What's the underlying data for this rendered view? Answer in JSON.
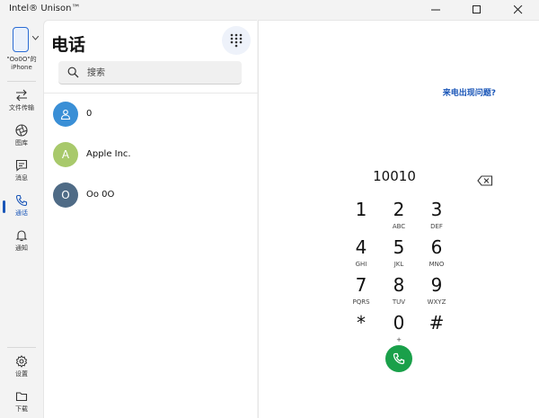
{
  "window": {
    "title": "Intel® Unison™"
  },
  "nav": {
    "device_name": "\"Oo0O\"的 iPhone",
    "items": [
      {
        "label": "文件传输",
        "icon": "transfer-icon"
      },
      {
        "label": "图库",
        "icon": "gallery-icon"
      },
      {
        "label": "消息",
        "icon": "message-icon"
      },
      {
        "label": "通话",
        "icon": "phone-icon",
        "active": true
      },
      {
        "label": "通知",
        "icon": "bell-icon"
      }
    ],
    "bottom_items": [
      {
        "label": "设置",
        "icon": "gear-icon"
      },
      {
        "label": "下载",
        "icon": "folder-icon"
      }
    ],
    "accent": "#1a56b8"
  },
  "phone": {
    "title": "电话",
    "search_placeholder": "搜索",
    "contacts": [
      {
        "initial": "",
        "name": "0",
        "color": "#3a8fd6",
        "icon": "person-icon"
      },
      {
        "initial": "A",
        "name": "Apple Inc.",
        "color": "#a8c96b"
      },
      {
        "initial": "O",
        "name": "Oo 0O",
        "color": "#4f6b86"
      }
    ]
  },
  "dialer": {
    "help_link": "来电出现问题?",
    "number": "10010",
    "keys": [
      {
        "digit": "1",
        "letters": ""
      },
      {
        "digit": "2",
        "letters": "ABC"
      },
      {
        "digit": "3",
        "letters": "DEF"
      },
      {
        "digit": "4",
        "letters": "GHI"
      },
      {
        "digit": "5",
        "letters": "JKL"
      },
      {
        "digit": "6",
        "letters": "MNO"
      },
      {
        "digit": "7",
        "letters": "PQRS"
      },
      {
        "digit": "8",
        "letters": "TUV"
      },
      {
        "digit": "9",
        "letters": "WXYZ"
      },
      {
        "digit": "*",
        "letters": ""
      },
      {
        "digit": "0",
        "letters": "+"
      },
      {
        "digit": "#",
        "letters": ""
      }
    ],
    "call_color": "#1aa04a"
  }
}
